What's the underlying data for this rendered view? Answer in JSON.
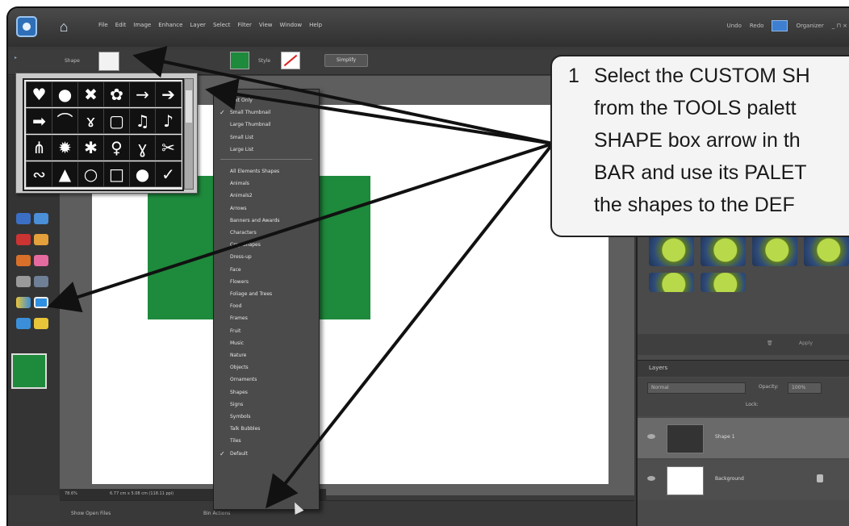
{
  "app": {
    "menus": [
      "File",
      "Edit",
      "Image",
      "Enhance",
      "Layer",
      "Select",
      "Filter",
      "View",
      "Window",
      "Help"
    ],
    "undo_label": "Undo",
    "redo_label": "Redo",
    "organizer_label": "Organizer",
    "window_controls": "_ ⊓ ×"
  },
  "options_bar": {
    "shape_label": "Shape",
    "style_label": "Style",
    "simplify_label": "Simplify",
    "color_swatch": "#1e8a3c"
  },
  "shape_palette": {
    "shapes": [
      "heart-card-icon",
      "speech-bubble-icon",
      "butterfly-icon",
      "paw-print-icon",
      "arrow-thin-icon",
      "arrow-outline-icon",
      "arrow-thick-icon",
      "arc-icon",
      "figure-icon",
      "frame-icon",
      "music-notes-icon",
      "music-note-icon",
      "grass-icon",
      "sunburst-icon",
      "splat-icon",
      "bulb-icon",
      "puppet-icon",
      "scissors-icon",
      "mustache-icon",
      "footprint-icon",
      "circle-outline-icon",
      "square-frame-icon",
      "circle-filled-icon",
      "checkmark-icon"
    ],
    "glyphs": [
      "♥",
      "●",
      "✖",
      "✿",
      "→",
      "➔",
      "➡",
      "⌒",
      "ɤ",
      "▢",
      "♫",
      "♪",
      "⋔",
      "✹",
      "✱",
      "♀",
      "ɣ",
      "✂",
      "∾",
      "▲",
      "○",
      "□",
      "●",
      "✓"
    ]
  },
  "palette_menu": {
    "view_options": [
      {
        "label": "Text Only",
        "checked": false
      },
      {
        "label": "Small Thumbnail",
        "checked": true
      },
      {
        "label": "Large Thumbnail",
        "checked": false
      },
      {
        "label": "Small List",
        "checked": false
      },
      {
        "label": "Large List",
        "checked": false
      }
    ],
    "sets": [
      {
        "label": "All Elements Shapes",
        "checked": false
      },
      {
        "label": "Animals",
        "checked": false
      },
      {
        "label": "Animals2",
        "checked": false
      },
      {
        "label": "Arrows",
        "checked": false
      },
      {
        "label": "Banners and Awards",
        "checked": false
      },
      {
        "label": "Characters",
        "checked": false
      },
      {
        "label": "Crop Shapes",
        "checked": false
      },
      {
        "label": "Dress-up",
        "checked": false
      },
      {
        "label": "Face",
        "checked": false
      },
      {
        "label": "Flowers",
        "checked": false
      },
      {
        "label": "Foliage and Trees",
        "checked": false
      },
      {
        "label": "Food",
        "checked": false
      },
      {
        "label": "Frames",
        "checked": false
      },
      {
        "label": "Fruit",
        "checked": false
      },
      {
        "label": "Music",
        "checked": false
      },
      {
        "label": "Nature",
        "checked": false
      },
      {
        "label": "Objects",
        "checked": false
      },
      {
        "label": "Ornaments",
        "checked": false
      },
      {
        "label": "Shapes",
        "checked": false
      },
      {
        "label": "Signs",
        "checked": false
      },
      {
        "label": "Symbols",
        "checked": false
      },
      {
        "label": "Talk Bubbles",
        "checked": false
      },
      {
        "label": "Tiles",
        "checked": false
      },
      {
        "label": "Default",
        "checked": true
      }
    ]
  },
  "status_bar": {
    "zoom": "78.6%",
    "doc_size": "6.77 cm x 5.08 cm (118.11 ppi)"
  },
  "bin_bar": {
    "show_open_files": "Show Open Files",
    "bin_actions": "Bin Actions"
  },
  "right_panel": {
    "apply_label": "Apply",
    "layers_title": "Layers",
    "blend_mode": "Normal",
    "opacity_label": "Opacity:",
    "opacity_value": "100%",
    "lock_label": "Lock:",
    "layers": [
      {
        "name": "Shape 1",
        "selected": true
      },
      {
        "name": "Background",
        "selected": false
      }
    ]
  },
  "callout": {
    "number": "1",
    "lines": [
      "Select the CUSTOM SH",
      "from the TOOLS palett",
      "SHAPE box arrow in th",
      "BAR and use its PALET",
      "the shapes to the DEF"
    ]
  },
  "colors": {
    "shape_green": "#1e8a3c",
    "app_dark": "#3a3a3a"
  }
}
